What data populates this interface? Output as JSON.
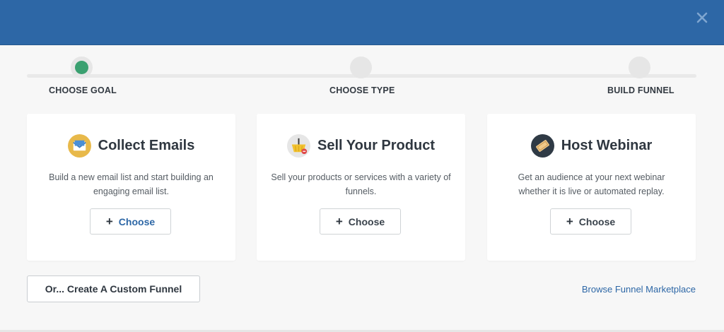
{
  "steps": [
    {
      "label": "CHOOSE GOAL",
      "active": true
    },
    {
      "label": "CHOOSE TYPE",
      "active": false
    },
    {
      "label": "BUILD FUNNEL",
      "active": false
    }
  ],
  "cards": [
    {
      "title": "Collect Emails",
      "description": "Build a new email list and start building an engaging email list.",
      "button_plus": "+",
      "button_label": "Choose",
      "icon": "email-envelope-icon"
    },
    {
      "title": "Sell Your Product",
      "description": "Sell your products or services with a variety of funnels.",
      "button_plus": "+",
      "button_label": "Choose",
      "icon": "shopping-basket-icon"
    },
    {
      "title": "Host Webinar",
      "description": "Get an audience at your next webinar whether it is live or automated replay.",
      "button_plus": "+",
      "button_label": "Choose",
      "icon": "ticket-icon"
    }
  ],
  "footer": {
    "custom_funnel_label": "Or... Create A Custom Funnel",
    "marketplace_link": "Browse Funnel Marketplace"
  },
  "colors": {
    "header": "#2d67a6",
    "active_step": "#3aa070",
    "link": "#2d67a6"
  }
}
